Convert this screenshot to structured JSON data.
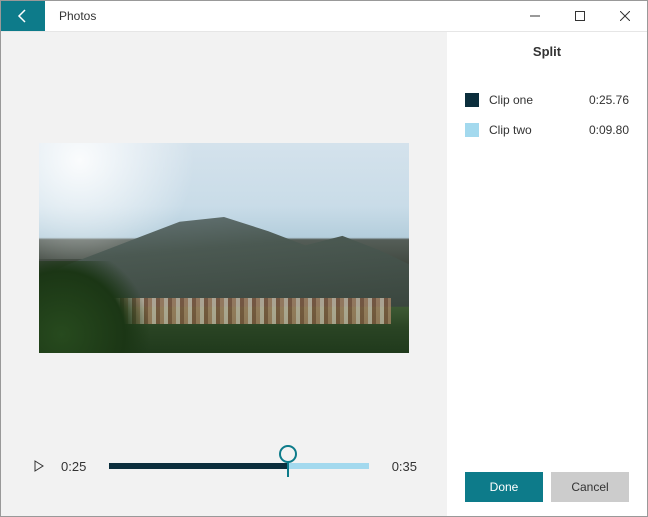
{
  "titlebar": {
    "app_name": "Photos"
  },
  "panel": {
    "title": "Split",
    "clips": [
      {
        "swatch": "#0b2e3c",
        "name": "Clip one",
        "duration": "0:25.76"
      },
      {
        "swatch": "#a3d9ee",
        "name": "Clip two",
        "duration": "0:09.80"
      }
    ]
  },
  "timeline": {
    "current_time": "0:25",
    "total_time": "0:35",
    "split_ratio_percent": 69
  },
  "buttons": {
    "done": "Done",
    "cancel": "Cancel"
  },
  "colors": {
    "accent": "#0d7b8a",
    "clip1": "#0b2e3c",
    "clip2": "#a3d9ee"
  }
}
